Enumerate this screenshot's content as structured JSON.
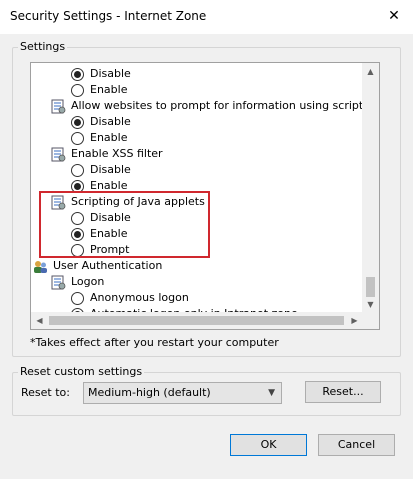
{
  "window": {
    "title": "Security Settings - Internet Zone",
    "close_glyph": "✕"
  },
  "settings_group": {
    "label": "Settings",
    "items": [
      {
        "kind": "option",
        "label": "Disable",
        "checked": true
      },
      {
        "kind": "option",
        "label": "Enable",
        "checked": false
      },
      {
        "kind": "setting",
        "label": "Allow websites to prompt for information using scripted windo",
        "icon": "settings-icon"
      },
      {
        "kind": "option",
        "label": "Disable",
        "checked": true
      },
      {
        "kind": "option",
        "label": "Enable",
        "checked": false
      },
      {
        "kind": "setting",
        "label": "Enable XSS filter",
        "icon": "settings-icon"
      },
      {
        "kind": "option",
        "label": "Disable",
        "checked": false
      },
      {
        "kind": "option",
        "label": "Enable",
        "checked": true
      },
      {
        "kind": "setting",
        "label": "Scripting of Java applets",
        "icon": "settings-icon"
      },
      {
        "kind": "option",
        "label": "Disable",
        "checked": false
      },
      {
        "kind": "option",
        "label": "Enable",
        "checked": true
      },
      {
        "kind": "option",
        "label": "Prompt",
        "checked": false
      },
      {
        "kind": "category",
        "label": "User Authentication",
        "icon": "users-icon"
      },
      {
        "kind": "setting",
        "label": "Logon",
        "icon": "settings-icon"
      },
      {
        "kind": "option",
        "label": "Anonymous logon",
        "checked": false
      },
      {
        "kind": "option",
        "label": "Automatic logon only in Intranet zone",
        "checked": true
      }
    ],
    "note": "*Takes effect after you restart your computer"
  },
  "reset_group": {
    "label": "Reset custom settings",
    "reset_to_label": "Reset to:",
    "selected_level": "Medium-high (default)",
    "reset_button": "Reset..."
  },
  "buttons": {
    "ok": "OK",
    "cancel": "Cancel"
  },
  "colors": {
    "highlight_border": "#d0282e",
    "default_button_border": "#0078d7"
  }
}
